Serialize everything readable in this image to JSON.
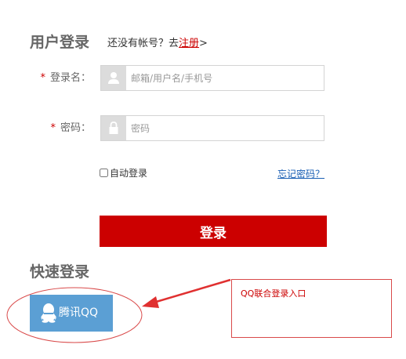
{
  "login": {
    "title": "用户登录",
    "register_prompt": "还没有帐号？去",
    "register_link": "注册",
    "register_suffix": ">"
  },
  "form": {
    "required_mark": "*",
    "username": {
      "label": "登录名：",
      "placeholder": "邮箱/用户名/手机号",
      "icon": "user-icon"
    },
    "password": {
      "label": "密码：",
      "placeholder": "密码",
      "icon": "lock-icon"
    },
    "auto_login": {
      "label": "自动登录",
      "checked": false
    },
    "forgot_password": "忘记密码？",
    "submit": "登录"
  },
  "quick_login": {
    "title": "快速登录",
    "qq_button_label": "腾讯QQ",
    "qq_icon": "qq-penguin-icon"
  },
  "annotation": {
    "text": "QQ联合登录入口",
    "color": "#cc0000"
  },
  "colors": {
    "accent_red": "#cc0000",
    "qq_blue": "#5b9fd4",
    "link_blue": "#1a5fb4"
  }
}
